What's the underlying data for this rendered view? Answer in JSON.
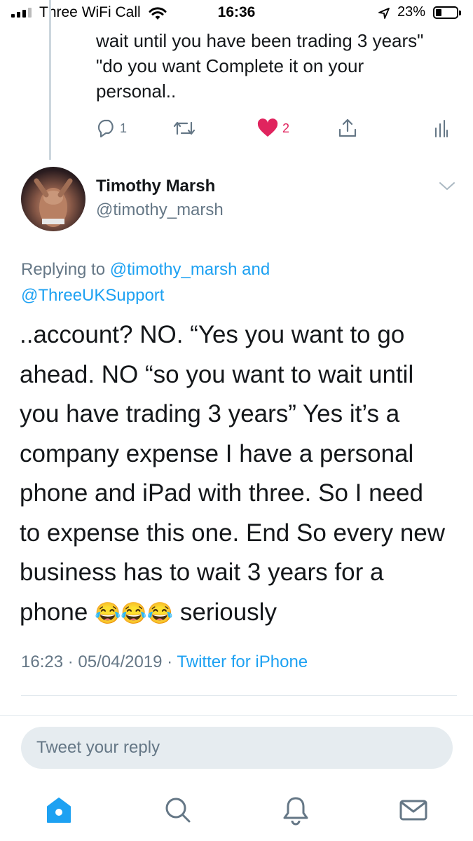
{
  "status_bar": {
    "carrier": "Three WiFi Call",
    "time": "16:36",
    "battery_percent": "23%",
    "battery_level": 0.23
  },
  "previous_tweet": {
    "lines": [
      "wait until you have been trading 3 years\"",
      "\"do you want Complete it on your",
      "personal.."
    ],
    "replies_count": "1",
    "likes_count": "2"
  },
  "tweet": {
    "author_name": "Timothy Marsh",
    "author_handle": "@timothy_marsh",
    "replying_prefix": "Replying to",
    "replying_user1": "@timothy_marsh",
    "replying_and": "and",
    "replying_user2": "@ThreeUKSupport",
    "body_lines": [
      "..account? NO. “Yes you want to go",
      "ahead. NO “so you want to wait until",
      "you have trading 3 years” Yes it’s a",
      "company expense I have a personal",
      "phone and iPad with three. So I need",
      "to expense this one. End So every new",
      "business has to wait 3 years for a"
    ],
    "body_last_start": "phone",
    "body_emojis": "😂😂😂",
    "body_last_end": "seriously",
    "timestamp": "16:23 · 05/04/2019 ·",
    "source": "Twitter for iPhone"
  },
  "reply_box": {
    "placeholder": "Tweet your reply"
  },
  "colors": {
    "link": "#1da1f2",
    "like": "#e0245e",
    "muted": "#657786"
  }
}
